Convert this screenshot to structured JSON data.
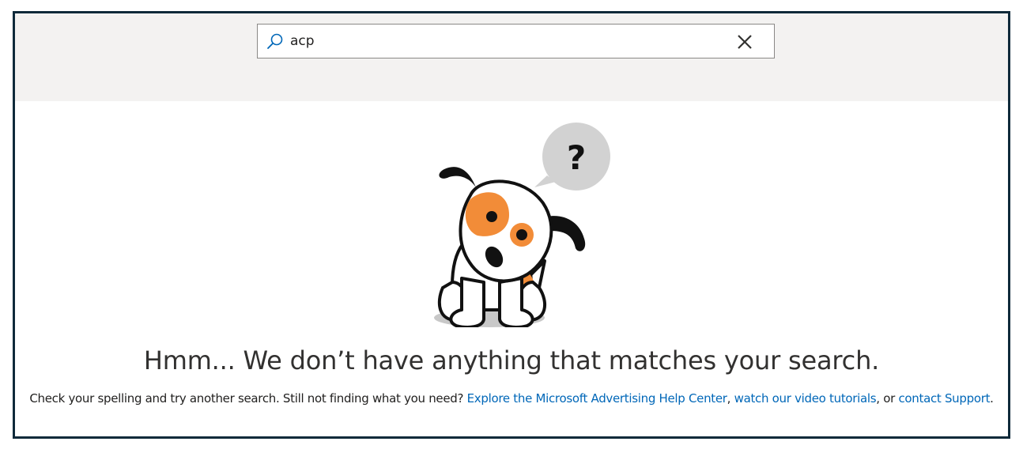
{
  "search": {
    "value": "acp",
    "icon": "search-icon",
    "clear_icon": "close-icon"
  },
  "empty_state": {
    "illustration": "puppy-illustration",
    "bubble_text": "?",
    "headline": "Hmm... We don’t have anything that matches your search.",
    "message_prefix": "Check your spelling and try another search. Still not finding what you need? ",
    "help_center_link": "Explore the Microsoft Advertising Help Center",
    "separator_1": ", ",
    "video_link": "watch our video tutorials",
    "separator_2": ", or ",
    "support_link": "contact Support",
    "message_suffix": "."
  },
  "colors": {
    "frame_border": "#0f2a3a",
    "search_band": "#f3f2f1",
    "link": "#0067b8",
    "puppy_spot": "#f28c38",
    "bubble": "#d2d2d2"
  }
}
